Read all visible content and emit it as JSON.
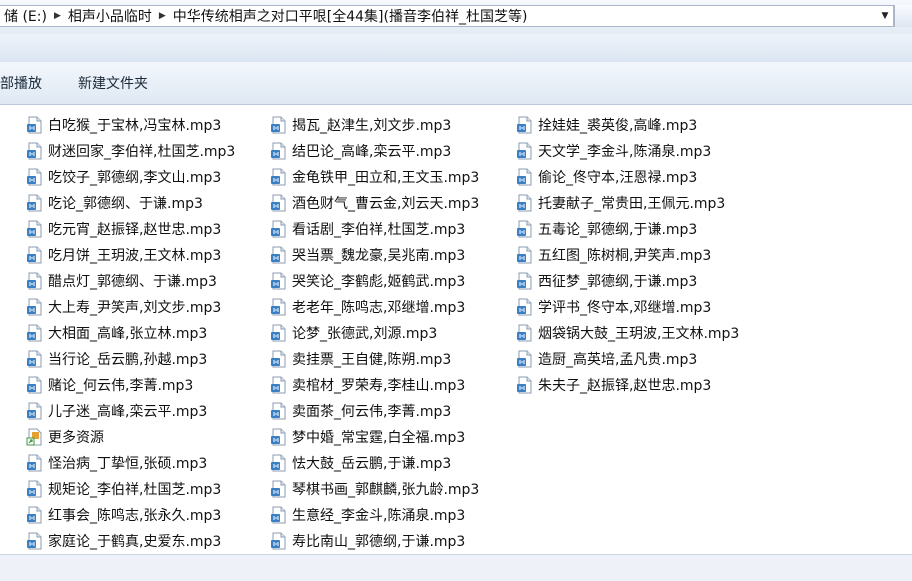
{
  "address_bar": {
    "segments": [
      "储 (E:)",
      "相声小品临时",
      "中华传统相声之对口平哏[全44集](播音李伯祥_杜国芝等)"
    ]
  },
  "toolbar": {
    "buttons": [
      "部播放",
      "新建文件夹"
    ]
  },
  "files": {
    "columns": [
      [
        {
          "name": "白吃猴_于宝林,冯宝林.mp3",
          "type": "audio"
        },
        {
          "name": "财迷回家_李伯祥,杜国芝.mp3",
          "type": "audio"
        },
        {
          "name": "吃饺子_郭德纲,李文山.mp3",
          "type": "audio"
        },
        {
          "name": "吃论_郭德纲、于谦.mp3",
          "type": "audio"
        },
        {
          "name": "吃元宵_赵振铎,赵世忠.mp3",
          "type": "audio"
        },
        {
          "name": "吃月饼_王玥波,王文林.mp3",
          "type": "audio"
        },
        {
          "name": "醋点灯_郭德纲、于谦.mp3",
          "type": "audio"
        },
        {
          "name": "大上寿_尹笑声,刘文步.mp3",
          "type": "audio"
        },
        {
          "name": "大相面_高峰,张立林.mp3",
          "type": "audio"
        },
        {
          "name": "当行论_岳云鹏,孙越.mp3",
          "type": "audio"
        },
        {
          "name": "赌论_何云伟,李菁.mp3",
          "type": "audio"
        },
        {
          "name": "儿子迷_高峰,栾云平.mp3",
          "type": "audio"
        },
        {
          "name": "更多资源",
          "type": "shortcut"
        },
        {
          "name": "怪治病_丁挚恒,张硕.mp3",
          "type": "audio"
        },
        {
          "name": "规矩论_李伯祥,杜国芝.mp3",
          "type": "audio"
        },
        {
          "name": "红事会_陈鸣志,张永久.mp3",
          "type": "audio"
        },
        {
          "name": "家庭论_于鹤真,史爱东.mp3",
          "type": "audio"
        }
      ],
      [
        {
          "name": "揭瓦_赵津生,刘文步.mp3",
          "type": "audio"
        },
        {
          "name": "结巴论_高峰,栾云平.mp3",
          "type": "audio"
        },
        {
          "name": "金龟铁甲_田立和,王文玉.mp3",
          "type": "audio"
        },
        {
          "name": "酒色财气_曹云金,刘云天.mp3",
          "type": "audio"
        },
        {
          "name": "看话剧_李伯祥,杜国芝.mp3",
          "type": "audio"
        },
        {
          "name": "哭当票_魏龙豪,吴兆南.mp3",
          "type": "audio"
        },
        {
          "name": "哭笑论_李鹤彪,姬鹤武.mp3",
          "type": "audio"
        },
        {
          "name": "老老年_陈鸣志,邓继增.mp3",
          "type": "audio"
        },
        {
          "name": "论梦_张德武,刘源.mp3",
          "type": "audio"
        },
        {
          "name": "卖挂票_王自健,陈朔.mp3",
          "type": "audio"
        },
        {
          "name": "卖棺材_罗荣寿,李桂山.mp3",
          "type": "audio"
        },
        {
          "name": "卖面茶_何云伟,李菁.mp3",
          "type": "audio"
        },
        {
          "name": "梦中婚_常宝霆,白全福.mp3",
          "type": "audio"
        },
        {
          "name": "怯大鼓_岳云鹏,于谦.mp3",
          "type": "audio"
        },
        {
          "name": "琴棋书画_郭麒麟,张九龄.mp3",
          "type": "audio"
        },
        {
          "name": "生意经_李金斗,陈涌泉.mp3",
          "type": "audio"
        },
        {
          "name": "寿比南山_郭德纲,于谦.mp3",
          "type": "audio"
        }
      ],
      [
        {
          "name": "拴娃娃_裘英俊,高峰.mp3",
          "type": "audio"
        },
        {
          "name": "天文学_李金斗,陈涌泉.mp3",
          "type": "audio"
        },
        {
          "name": "偷论_佟守本,汪恩禄.mp3",
          "type": "audio"
        },
        {
          "name": "托妻献子_常贵田,王佩元.mp3",
          "type": "audio"
        },
        {
          "name": "五毒论_郭德纲,于谦.mp3",
          "type": "audio"
        },
        {
          "name": "五红图_陈树桐,尹笑声.mp3",
          "type": "audio"
        },
        {
          "name": "西征梦_郭德纲,于谦.mp3",
          "type": "audio"
        },
        {
          "name": "学评书_佟守本,邓继增.mp3",
          "type": "audio"
        },
        {
          "name": "烟袋锅大鼓_王玥波,王文林.mp3",
          "type": "audio"
        },
        {
          "name": "造厨_高英培,孟凡贵.mp3",
          "type": "audio"
        },
        {
          "name": "朱夫子_赵振铎,赵世忠.mp3",
          "type": "audio"
        }
      ]
    ]
  },
  "colors": {
    "audio_icon_blue": "#3a7fc4",
    "shortcut_icon_orange": "#e8a030",
    "shortcut_icon_green": "#3d9a3d"
  }
}
